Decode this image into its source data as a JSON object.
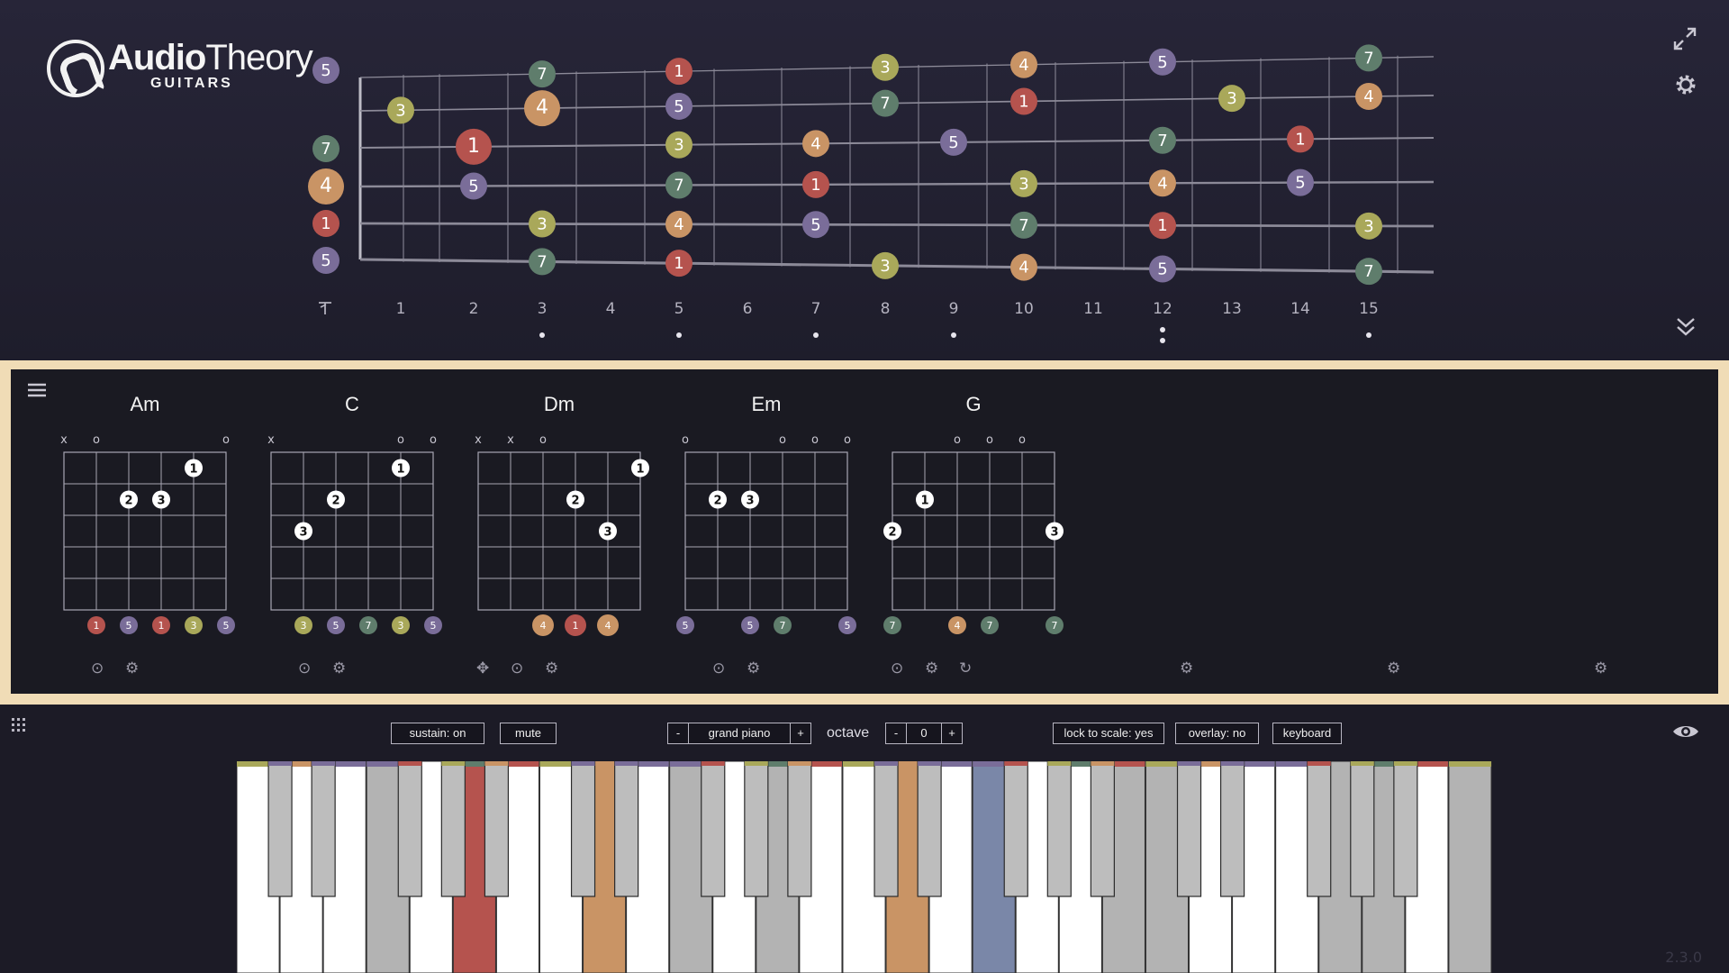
{
  "app": {
    "logo_text_a": "Audio",
    "logo_text_b": "Theory",
    "logo_sub": "GUITARS",
    "version": "2.3.0"
  },
  "colors": {
    "degree_1": "#b5534e",
    "degree_3": "#a9a85a",
    "degree_4": "#c99465",
    "degree_5": "#7a6d99",
    "degree_7": "#5f7d6c",
    "panel_border": "#f0dcb6"
  },
  "fretboard": {
    "fret_labels": [
      "1",
      "2",
      "3",
      "4",
      "5",
      "6",
      "7",
      "8",
      "9",
      "10",
      "11",
      "12",
      "13",
      "14",
      "15"
    ],
    "open_label": "⸗",
    "inlay_single": [
      3,
      5,
      7,
      9,
      15
    ],
    "inlay_double": [
      12
    ],
    "notes": [
      {
        "string": 1,
        "fret": 0,
        "label": "5"
      },
      {
        "string": 1,
        "fret": 3,
        "label": "7"
      },
      {
        "string": 1,
        "fret": 5,
        "label": "1"
      },
      {
        "string": 1,
        "fret": 8,
        "label": "3"
      },
      {
        "string": 1,
        "fret": 10,
        "label": "4"
      },
      {
        "string": 1,
        "fret": 12,
        "label": "5"
      },
      {
        "string": 1,
        "fret": 15,
        "label": "7"
      },
      {
        "string": 2,
        "fret": 1,
        "label": "3"
      },
      {
        "string": 2,
        "fret": 3,
        "label": "4"
      },
      {
        "string": 2,
        "fret": 5,
        "label": "5"
      },
      {
        "string": 2,
        "fret": 8,
        "label": "7"
      },
      {
        "string": 2,
        "fret": 10,
        "label": "1"
      },
      {
        "string": 2,
        "fret": 13,
        "label": "3"
      },
      {
        "string": 2,
        "fret": 15,
        "label": "4"
      },
      {
        "string": 3,
        "fret": 0,
        "label": "7"
      },
      {
        "string": 3,
        "fret": 2,
        "label": "1"
      },
      {
        "string": 3,
        "fret": 5,
        "label": "3"
      },
      {
        "string": 3,
        "fret": 7,
        "label": "4"
      },
      {
        "string": 3,
        "fret": 9,
        "label": "5"
      },
      {
        "string": 3,
        "fret": 12,
        "label": "7"
      },
      {
        "string": 3,
        "fret": 14,
        "label": "1"
      },
      {
        "string": 4,
        "fret": 0,
        "label": "4"
      },
      {
        "string": 4,
        "fret": 2,
        "label": "5"
      },
      {
        "string": 4,
        "fret": 5,
        "label": "7"
      },
      {
        "string": 4,
        "fret": 7,
        "label": "1"
      },
      {
        "string": 4,
        "fret": 10,
        "label": "3"
      },
      {
        "string": 4,
        "fret": 12,
        "label": "4"
      },
      {
        "string": 4,
        "fret": 14,
        "label": "5"
      },
      {
        "string": 5,
        "fret": 0,
        "label": "1"
      },
      {
        "string": 5,
        "fret": 3,
        "label": "3"
      },
      {
        "string": 5,
        "fret": 5,
        "label": "4"
      },
      {
        "string": 5,
        "fret": 7,
        "label": "5"
      },
      {
        "string": 5,
        "fret": 10,
        "label": "7"
      },
      {
        "string": 5,
        "fret": 12,
        "label": "1"
      },
      {
        "string": 5,
        "fret": 15,
        "label": "3"
      },
      {
        "string": 6,
        "fret": 0,
        "label": "5"
      },
      {
        "string": 6,
        "fret": 3,
        "label": "7"
      },
      {
        "string": 6,
        "fret": 5,
        "label": "1"
      },
      {
        "string": 6,
        "fret": 8,
        "label": "3"
      },
      {
        "string": 6,
        "fret": 10,
        "label": "4"
      },
      {
        "string": 6,
        "fret": 12,
        "label": "5"
      },
      {
        "string": 6,
        "fret": 15,
        "label": "7"
      }
    ]
  },
  "icons": {
    "expand": "expand-icon",
    "settings": "gear-icon",
    "collapse": "double-chevron-down-icon",
    "menu": "hamburger-menu-icon",
    "grid": "grid-icon",
    "eye": "eye-icon"
  },
  "chords": [
    {
      "name": "Am",
      "open": [
        "x",
        "o",
        "",
        "",
        "",
        "o"
      ],
      "fingers": [
        {
          "s": 5,
          "f": 1,
          "n": "1"
        },
        {
          "s": 3,
          "f": 2,
          "n": "2"
        },
        {
          "s": 4,
          "f": 2,
          "n": "3"
        }
      ],
      "degrees": [
        "",
        "1",
        "5",
        "1",
        "3",
        "5"
      ],
      "controls": [
        "play",
        "settings"
      ]
    },
    {
      "name": "C",
      "open": [
        "x",
        "",
        "",
        "",
        "o",
        "o"
      ],
      "fingers": [
        {
          "s": 5,
          "f": 1,
          "n": "1"
        },
        {
          "s": 3,
          "f": 2,
          "n": "2"
        },
        {
          "s": 2,
          "f": 3,
          "n": "3"
        }
      ],
      "degrees": [
        "",
        "3",
        "5",
        "7",
        "3",
        "5"
      ],
      "controls": [
        "play",
        "settings"
      ]
    },
    {
      "name": "Dm",
      "open": [
        "x",
        "x",
        "o",
        "",
        "",
        ""
      ],
      "fingers": [
        {
          "s": 6,
          "f": 1,
          "n": "1"
        },
        {
          "s": 4,
          "f": 2,
          "n": "2"
        },
        {
          "s": 5,
          "f": 3,
          "n": "3"
        }
      ],
      "degrees": [
        "",
        "",
        "4",
        "1",
        "4",
        ""
      ],
      "controls": [
        "move",
        "play",
        "settings"
      ]
    },
    {
      "name": "Em",
      "open": [
        "o",
        "",
        "",
        "o",
        "o",
        "o"
      ],
      "fingers": [
        {
          "s": 2,
          "f": 2,
          "n": "2"
        },
        {
          "s": 3,
          "f": 2,
          "n": "3"
        }
      ],
      "degrees": [
        "5",
        "",
        "5",
        "7",
        "",
        "5"
      ],
      "controls": [
        "play",
        "settings"
      ]
    },
    {
      "name": "G",
      "open": [
        "",
        "",
        "o",
        "o",
        "o",
        ""
      ],
      "fingers": [
        {
          "s": 2,
          "f": 2,
          "n": "1"
        },
        {
          "s": 1,
          "f": 3,
          "n": "2"
        },
        {
          "s": 6,
          "f": 3,
          "n": "3"
        }
      ],
      "degrees": [
        "7",
        "",
        "4",
        "7",
        "",
        "7"
      ],
      "controls": [
        "play",
        "settings",
        "loop"
      ]
    }
  ],
  "empty_slot_controls": [
    "settings",
    "settings",
    "settings"
  ],
  "keyboard_bar": {
    "sustain": "sustain: on",
    "mute": "mute",
    "minus": "-",
    "plus": "+",
    "instrument": "grand piano",
    "octave_label": "octave",
    "octave_value": "0",
    "lock": "lock to scale: yes",
    "overlay": "overlay: no",
    "keyboard": "keyboard"
  }
}
